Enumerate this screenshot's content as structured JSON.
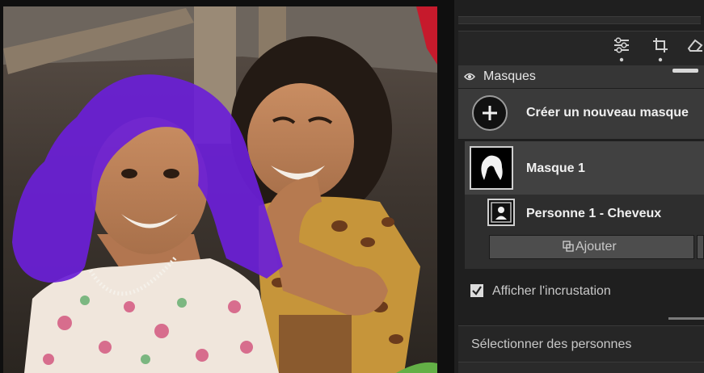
{
  "photo": {
    "icon": "photo-preview",
    "overlay_color": "#6a1fd6"
  },
  "toolbar": {
    "icons": [
      "sliders-icon",
      "crop-icon",
      "eraser-icon"
    ]
  },
  "masks_panel": {
    "title": "Masques",
    "create_label": "Créer un nouveau masque",
    "mask_name": "Masque 1",
    "component_name": "Personne 1 - Cheveux",
    "add_label": "Ajouter",
    "overlay_checkbox_label": "Afficher l'incrustation",
    "overlay_checked": true,
    "select_people_label": "Sélectionner des personnes"
  }
}
